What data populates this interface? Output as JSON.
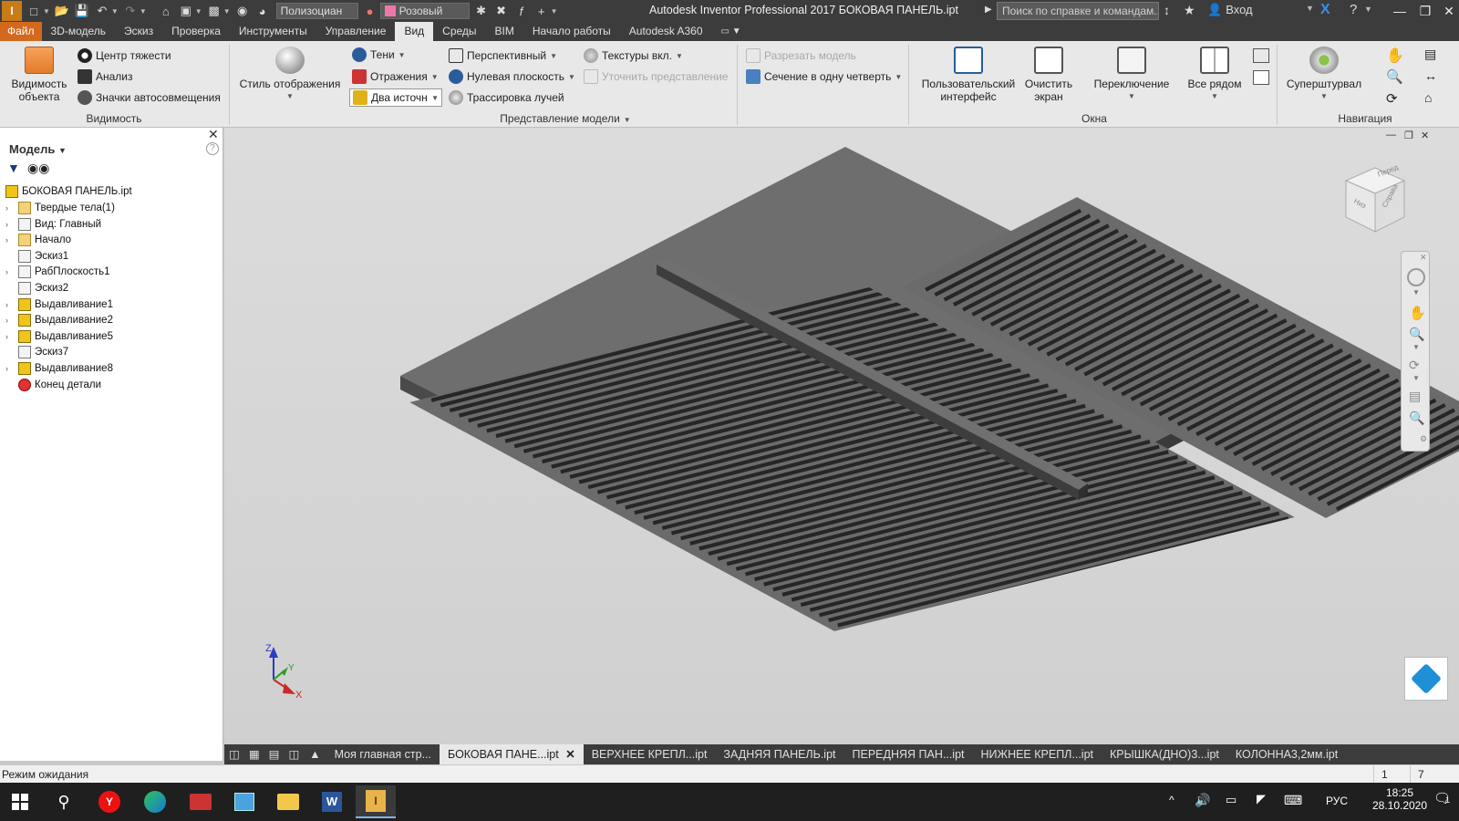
{
  "titlebar": {
    "style_combo": "Полизоциан",
    "color_combo": "Розовый",
    "app_title": "Autodesk Inventor Professional 2017   БОКОВАЯ ПАНЕЛЬ.ipt",
    "search_placeholder": "Поиск по справке и командам...",
    "login_label": "Вход"
  },
  "menu": {
    "file": "Файл",
    "tabs": [
      "3D-модель",
      "Эскиз",
      "Проверка",
      "Инструменты",
      "Управление",
      "Вид",
      "Среды",
      "BIM",
      "Начало работы",
      "Autodesk A360"
    ],
    "active": "Вид"
  },
  "ribbon": {
    "visibility": {
      "big_label": "Видимость\nобъекта",
      "items": [
        "Центр тяжести",
        "Анализ",
        "Значки автосовмещения"
      ],
      "group_label": "Видимость"
    },
    "model_view": {
      "display_style": "Стиль отображения",
      "shadows": "Тени",
      "reflections": "Отражения",
      "lights": "Два источн",
      "perspective": "Перспективный",
      "ground_plane": "Нулевая плоскость",
      "ray_tracing": "Трассировка лучей",
      "textures": "Текстуры вкл.",
      "refine": "Уточнить представление",
      "group_label": "Представление модели"
    },
    "section": {
      "cut": "Разрезать модель",
      "quarter": "Сечение в одну четверть"
    },
    "windows": {
      "user_interface": "Пользовательский\nинтерфейс",
      "clean_screen": "Очистить\nэкран",
      "switch": "Переключение",
      "tile": "Все рядом",
      "group_label": "Окна"
    },
    "navigation": {
      "steering_wheel": "Суперштурвал",
      "group_label": "Навигация"
    }
  },
  "browser": {
    "title": "Модель",
    "root": "БОКОВАЯ ПАНЕЛЬ.ipt",
    "items": [
      {
        "label": "Твердые тела(1)",
        "icon": "solid-bodies-icon",
        "expand": true
      },
      {
        "label": "Вид: Главный",
        "icon": "view-icon",
        "expand": true
      },
      {
        "label": "Начало",
        "icon": "folder-icon",
        "expand": true
      },
      {
        "label": "Эскиз1",
        "icon": "sketch-icon",
        "expand": false
      },
      {
        "label": "РабПлоскость1",
        "icon": "workplane-icon",
        "expand": true
      },
      {
        "label": "Эскиз2",
        "icon": "sketch-icon",
        "expand": false
      },
      {
        "label": "Выдавливание1",
        "icon": "extrude-icon",
        "expand": true
      },
      {
        "label": "Выдавливание2",
        "icon": "extrude-icon",
        "expand": true
      },
      {
        "label": "Выдавливание5",
        "icon": "extrude-icon",
        "expand": true
      },
      {
        "label": "Эскиз7",
        "icon": "sketch-icon",
        "expand": false
      },
      {
        "label": "Выдавливание8",
        "icon": "extrude-icon",
        "expand": true
      },
      {
        "label": "Конец детали",
        "icon": "end-of-part-icon",
        "expand": false
      }
    ]
  },
  "viewcube": {
    "front": "Перед",
    "right": "Справа",
    "top": "Низ"
  },
  "axes": {
    "x": "X",
    "y": "Y",
    "z": "Z"
  },
  "doctabs": {
    "home": "Моя главная стр...",
    "tabs": [
      "БОКОВАЯ ПАНЕ...ipt",
      "ВЕРХНЕЕ КРЕПЛ...ipt",
      "ЗАДНЯЯ ПАНЕЛЬ.ipt",
      "ПЕРЕДНЯЯ ПАН...ipt",
      "НИЖНЕЕ КРЕПЛ...ipt",
      "КРЫШКА(ДНО)3...ipt",
      "КОЛОННА3,2мм.ipt"
    ],
    "active_index": 0
  },
  "status": {
    "text": "Режим ожидания",
    "count1": "1",
    "count2": "7"
  },
  "taskbar": {
    "lang": "РУС",
    "time": "18:25",
    "date": "28.10.2020",
    "notifications": "1"
  }
}
